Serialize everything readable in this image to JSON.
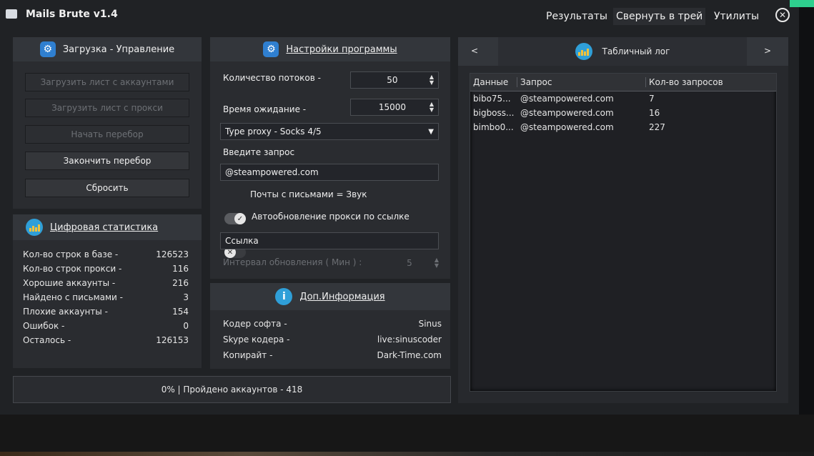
{
  "app": {
    "title": "Mails Brute v1.4"
  },
  "menu": {
    "results": "Результаты",
    "tray": "Свернуть в трей",
    "utilities": "Утилиты"
  },
  "control": {
    "header": "Загрузка - Управление",
    "buttons": {
      "load_accounts": "Загрузить лист с аккаунтами",
      "load_proxy": "Загрузить лист с прокси",
      "start": "Начать перебор",
      "finish": "Закончить перебор",
      "reset": "Сбросить"
    }
  },
  "stats": {
    "header": "Цифровая статистика",
    "rows": [
      {
        "label": "Кол-во строк в базе -",
        "value": "126523"
      },
      {
        "label": "Кол-во строк прокси -",
        "value": "116"
      },
      {
        "label": "Хорошие аккаунты -",
        "value": "216"
      },
      {
        "label": "Найдено с письмами -",
        "value": "3"
      },
      {
        "label": "Плохие аккаунты -",
        "value": "154"
      },
      {
        "label": "Ошибок -",
        "value": "0"
      },
      {
        "label": "Осталось -",
        "value": "126153"
      }
    ]
  },
  "progress": {
    "text": "0% | Пройдено аккаунтов - 418"
  },
  "settings": {
    "header": "Настройки программы",
    "threads_label": "Количество потоков -",
    "threads_value": "50",
    "timeout_label": "Время ожидание -",
    "timeout_value": "15000",
    "proxy_type": "Type proxy - Socks 4/5",
    "query_label": "Введите запрос",
    "query_value": "@steampowered.com",
    "sound_toggle_label": "Почты с письмами = Звук",
    "auto_proxy_label": "Автообновление прокси по ссылке",
    "link_value": "Ссылка",
    "interval_label": "Интервал обновления ( Мин ) :",
    "interval_value": "5"
  },
  "info": {
    "header": "Доп.Информация",
    "rows": [
      {
        "label": "Кодер софта -",
        "value": "Sinus"
      },
      {
        "label": "Skype кодера -",
        "value": "live:sinuscoder"
      },
      {
        "label": "Копирайт -",
        "value": "Dark-Time.com"
      }
    ]
  },
  "log": {
    "header": "Табличный лог",
    "prev": "<",
    "next": ">",
    "columns": [
      "Данные",
      "Запрос",
      "Кол-во запросов"
    ],
    "rows": [
      {
        "data": "bibo75...",
        "query": "@steampowered.com",
        "count": "7"
      },
      {
        "data": "bigboss...",
        "query": "@steampowered.com",
        "count": "16"
      },
      {
        "data": "bimbo0...",
        "query": "@steampowered.com",
        "count": "227"
      }
    ]
  },
  "icons": {
    "app": "envelope-icon",
    "close": "close-circle-icon",
    "gear": "gear-icon",
    "stats": "bar-chart-icon",
    "info": "info-icon"
  },
  "colors": {
    "accent": "#2f7fd0",
    "window": "#202225",
    "panel_header": "#33363b"
  }
}
